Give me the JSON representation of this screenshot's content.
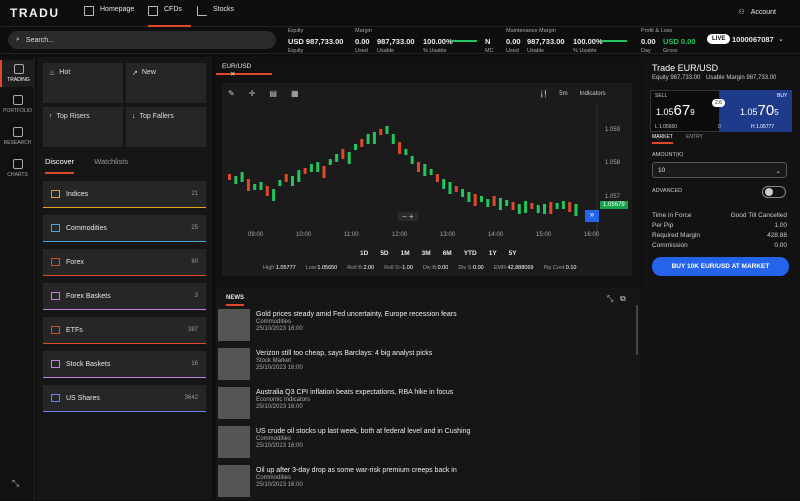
{
  "brand": "TRADU",
  "nav": {
    "home": "Homepage",
    "cfds": "CFDs",
    "stocks": "Stocks",
    "account": "Account"
  },
  "search": {
    "placeholder": "Search..."
  },
  "metrics": [
    {
      "label": "Equity",
      "value": "USD 987,733.00",
      "sub": "Equity"
    },
    {
      "label": "Margin",
      "value": "0.00",
      "value2": "987,733.00",
      "value3": "100.00%",
      "sub": "Used",
      "sub2": "Usable",
      "sub3": "% Usable",
      "n": "N",
      "nsub": "MC"
    },
    {
      "label": "Maintenance Margin",
      "value": "0.00",
      "value2": "987,733.00",
      "value3": "100.00%",
      "sub": "Used",
      "sub2": "Usable",
      "sub3": "% Usable"
    },
    {
      "label": "Profit & Loss",
      "value": "0.00",
      "value2": "USD 0.00",
      "sub": "Day",
      "sub2": "Gross"
    }
  ],
  "live": {
    "badge": "LIVE",
    "account": "1000067087"
  },
  "leftnav": [
    "TRADING",
    "PORTFOLIO",
    "RESEARCH",
    "CHARTS"
  ],
  "quick": [
    "Hot",
    "New",
    "Top Risers",
    "Top Fallers"
  ],
  "tabs": [
    "Discover",
    "Watchlists"
  ],
  "categories": [
    {
      "name": "Indices",
      "count": "21",
      "color": "#e8a020"
    },
    {
      "name": "Commodities",
      "count": "25",
      "color": "#4aa3df"
    },
    {
      "name": "Forex",
      "count": "80",
      "color": "#e0482c"
    },
    {
      "name": "Forex Baskets",
      "count": "3",
      "color": "#c77fe0"
    },
    {
      "name": "ETFs",
      "count": "387",
      "color": "#e0482c"
    },
    {
      "name": "Stock Baskets",
      "count": "16",
      "color": "#c77fe0"
    },
    {
      "name": "US Shares",
      "count": "3642",
      "color": "#6b7cff"
    }
  ],
  "chart_tab": "EUR/USD",
  "chart": {
    "interval": "5m",
    "indicators": "Indicators",
    "price_tag": "1.05679"
  },
  "chart_data": {
    "type": "candlestick",
    "x_ticks": [
      "09:00",
      "10:00",
      "11:00",
      "12:00",
      "13:00",
      "14:00",
      "15:00",
      "16:00"
    ],
    "y_ticks": [
      "1.059",
      "1.058",
      "1.057"
    ],
    "last": "1.05679"
  },
  "ranges": [
    "1D",
    "5D",
    "1M",
    "3M",
    "6M",
    "YTD",
    "1Y",
    "5Y"
  ],
  "stats": [
    {
      "k": "High:",
      "v": "1.05777"
    },
    {
      "k": "Low:",
      "v": "1.05650"
    },
    {
      "k": "Roll B:",
      "v": "2.00"
    },
    {
      "k": "Roll S:",
      "v": "-1.00"
    },
    {
      "k": "Div B:",
      "v": "0.00"
    },
    {
      "k": "Div S:",
      "v": "0.00"
    },
    {
      "k": "EMR:",
      "v": "42.888069"
    },
    {
      "k": "Pip Cost:",
      "v": "0.10"
    }
  ],
  "news": {
    "title": "NEWS",
    "items": [
      {
        "headline": "Gold prices steady amid Fed uncertainty, Europe recession fears",
        "cat": "Commodities",
        "date": "25/10/2023 16:00"
      },
      {
        "headline": "Verizon still too cheap, says Barclays: 4 big analyst picks",
        "cat": "Stock Market",
        "date": "25/10/2023 16:00"
      },
      {
        "headline": "Australia Q3 CPI inflation beats expectations, RBA hike in focus",
        "cat": "Economic Indicators",
        "date": "25/10/2023 16:00"
      },
      {
        "headline": "US crude oil stocks up last week, both at federal level and in Cushing",
        "cat": "Commodities",
        "date": "25/10/2023 16:00"
      },
      {
        "headline": "Oil up after 3-day drop as some war-risk premium creeps back in",
        "cat": "Commodities",
        "date": "25/10/2023 16:00"
      }
    ]
  },
  "trade": {
    "title": "Trade EUR/USD",
    "equity": "Equity 987,733.00",
    "usable": "Usable Margin 987,733.00",
    "sell_label": "SELL",
    "buy_label": "BUY",
    "sell_big": "1.05",
    "sell_pips": "67",
    "sell_frac": "9",
    "buy_big": "1.05",
    "buy_pips": "70",
    "buy_frac": "5",
    "spread": "2.6",
    "low": "L 1.05650",
    "zero": "0",
    "high": "H 1.05777",
    "tabs": [
      "MARKET",
      "ENTRY"
    ],
    "amount_label": "AMOUNT(K)",
    "amount": "10",
    "advanced": "ADVANCED",
    "tif_label": "Time in Force",
    "tif": "Good Till Cancelled",
    "perpip_label": "Per Pip",
    "perpip": "1.00",
    "margin_label": "Required Margin",
    "margin": "428.88",
    "comm_label": "Commission",
    "comm": "0.00",
    "button": "BUY 10K EUR/USD AT MARKET"
  }
}
